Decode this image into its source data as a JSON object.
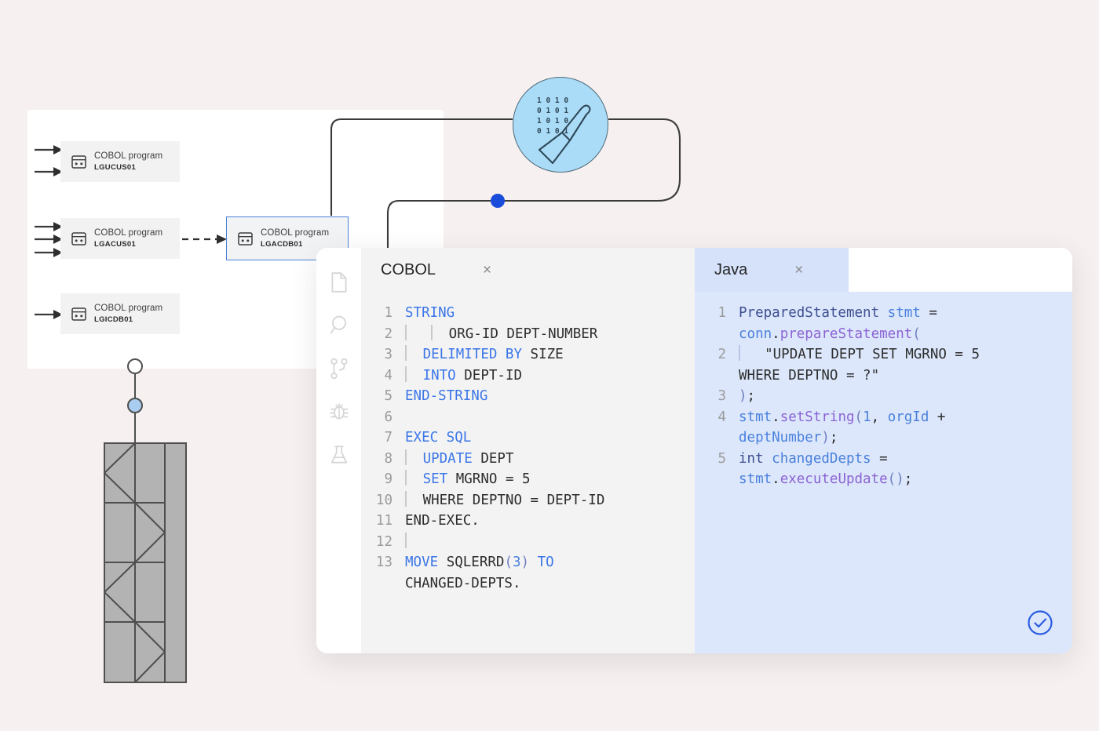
{
  "page": {
    "background_color": "#f6f0f0",
    "title": "COBOL to Java code conversion"
  },
  "diagram": {
    "card_background": "#ffffff",
    "nodes": [
      {
        "title": "COBOL program",
        "id": "LGUCUS01",
        "selected": false,
        "incoming_arrows": 2
      },
      {
        "title": "COBOL program",
        "id": "LGACUS01",
        "selected": false,
        "incoming_arrows": 3
      },
      {
        "title": "COBOL program",
        "id": "LGICDB01",
        "selected": false,
        "incoming_arrows": 1
      },
      {
        "title": "COBOL program",
        "id": "LGACDB01",
        "selected": true,
        "incoming_arrows": 1
      }
    ],
    "node_icon": "terminal-window-icon",
    "selected_outline_color": "#4a82d8",
    "connector_dot_color": "#1a4cdb"
  },
  "ai_badge": {
    "icon": "binary-wand-icon",
    "fill_color": "#aadcf8",
    "stroke_color": "#4e6a78"
  },
  "editor": {
    "activity_bar": {
      "items": [
        {
          "icon": "file-icon",
          "name": "explorer"
        },
        {
          "icon": "search-icon",
          "name": "search"
        },
        {
          "icon": "branch-icon",
          "name": "source-control"
        },
        {
          "icon": "bug-icon",
          "name": "run-and-debug"
        },
        {
          "icon": "flask-icon",
          "name": "testing"
        }
      ]
    },
    "status_icon": "check-circle-icon",
    "status_icon_color": "#2a5ce0",
    "tabs": [
      {
        "label": "COBOL",
        "close_label": "×",
        "active": true,
        "background": "#f3f3f3",
        "code": [
          {
            "n": "1",
            "tokens": [
              {
                "t": "STRING",
                "c": "k"
              }
            ]
          },
          {
            "n": "2",
            "tokens": [
              {
                "t": "guide"
              },
              {
                "t": "   "
              },
              {
                "t": "guide"
              },
              {
                "t": "  ORG-ID DEPT-NUMBER",
                "c": ""
              }
            ]
          },
          {
            "n": "3",
            "tokens": [
              {
                "t": "guide"
              },
              {
                "t": "  "
              },
              {
                "t": "DELIMITED BY",
                "c": "k"
              },
              {
                "t": " SIZE",
                "c": ""
              }
            ]
          },
          {
            "n": "4",
            "tokens": [
              {
                "t": "guide"
              },
              {
                "t": "  "
              },
              {
                "t": "INTO",
                "c": "k"
              },
              {
                "t": " DEPT-ID",
                "c": ""
              }
            ]
          },
          {
            "n": "5",
            "tokens": [
              {
                "t": "END-STRING",
                "c": "k"
              }
            ]
          },
          {
            "n": "6",
            "tokens": []
          },
          {
            "n": "7",
            "tokens": [
              {
                "t": "EXEC SQL",
                "c": "k"
              }
            ]
          },
          {
            "n": "8",
            "tokens": [
              {
                "t": "guide"
              },
              {
                "t": "  "
              },
              {
                "t": "UPDATE",
                "c": "k"
              },
              {
                "t": " DEPT",
                "c": ""
              }
            ]
          },
          {
            "n": "9",
            "tokens": [
              {
                "t": "guide"
              },
              {
                "t": "  "
              },
              {
                "t": "SET",
                "c": "k"
              },
              {
                "t": " MGRNO = 5",
                "c": ""
              }
            ]
          },
          {
            "n": "10",
            "tokens": [
              {
                "t": "guide"
              },
              {
                "t": "  WHERE DEPTNO = DEPT-ID",
                "c": ""
              }
            ]
          },
          {
            "n": "11",
            "tokens": [
              {
                "t": "END-EXEC.",
                "c": ""
              }
            ]
          },
          {
            "n": "12",
            "tokens": [
              {
                "t": "guide"
              }
            ]
          },
          {
            "n": "13",
            "tokens": [
              {
                "t": "MOVE",
                "c": "k"
              },
              {
                "t": " SQLERRD",
                "c": ""
              },
              {
                "t": "(",
                "c": "pl"
              },
              {
                "t": "3",
                "c": "jn"
              },
              {
                "t": ")",
                "c": "pl"
              },
              {
                "t": " ",
                "c": ""
              },
              {
                "t": "TO",
                "c": "k"
              },
              {
                "t": "\nCHANGED-DEPTS.",
                "c": ""
              }
            ]
          }
        ]
      },
      {
        "label": "Java",
        "close_label": "×",
        "active": true,
        "background": "#d5e2fa",
        "code": [
          {
            "n": "1",
            "tokens": [
              {
                "t": "PreparedStatement",
                "c": "jt"
              },
              {
                "t": " ",
                "c": ""
              },
              {
                "t": "stmt",
                "c": "jv"
              },
              {
                "t": " = \n",
                "c": ""
              },
              {
                "t": "conn",
                "c": "jv"
              },
              {
                "t": ".",
                "c": ""
              },
              {
                "t": "prepareStatement",
                "c": "jm"
              },
              {
                "t": "(",
                "c": "pl"
              }
            ]
          },
          {
            "n": "2",
            "tokens": [
              {
                "t": "guide-j"
              },
              {
                "t": "   \"UPDATE DEPT SET MGRNO = 5 \nWHERE DEPTNO = ?\"",
                "c": ""
              }
            ]
          },
          {
            "n": "3",
            "tokens": [
              {
                "t": ")",
                "c": "pl"
              },
              {
                "t": ";",
                "c": ""
              }
            ]
          },
          {
            "n": "4",
            "tokens": [
              {
                "t": "stmt",
                "c": "jv"
              },
              {
                "t": ".",
                "c": ""
              },
              {
                "t": "setString",
                "c": "jm"
              },
              {
                "t": "(",
                "c": "pl"
              },
              {
                "t": "1",
                "c": "jn"
              },
              {
                "t": ", ",
                "c": ""
              },
              {
                "t": "orgId",
                "c": "jv"
              },
              {
                "t": " + \n",
                "c": ""
              },
              {
                "t": "deptNumber",
                "c": "jv"
              },
              {
                "t": ")",
                "c": "pl"
              },
              {
                "t": ";",
                "c": ""
              }
            ]
          },
          {
            "n": "5",
            "tokens": [
              {
                "t": "int",
                "c": "jt"
              },
              {
                "t": " ",
                "c": ""
              },
              {
                "t": "changedDepts",
                "c": "jv"
              },
              {
                "t": " = \n",
                "c": ""
              },
              {
                "t": "stmt",
                "c": "jv"
              },
              {
                "t": ".",
                "c": ""
              },
              {
                "t": "executeUpdate",
                "c": "jm"
              },
              {
                "t": "()",
                "c": "pl"
              },
              {
                "t": ";",
                "c": ""
              }
            ]
          }
        ]
      }
    ]
  },
  "truss": {
    "name": "zigzag-truss-graphic",
    "handle_top_color": "#ffffff",
    "handle_mid_color": "#a8cdf0",
    "fill_color": "#b3b3b3",
    "stroke_color": "#4f4f4f"
  }
}
